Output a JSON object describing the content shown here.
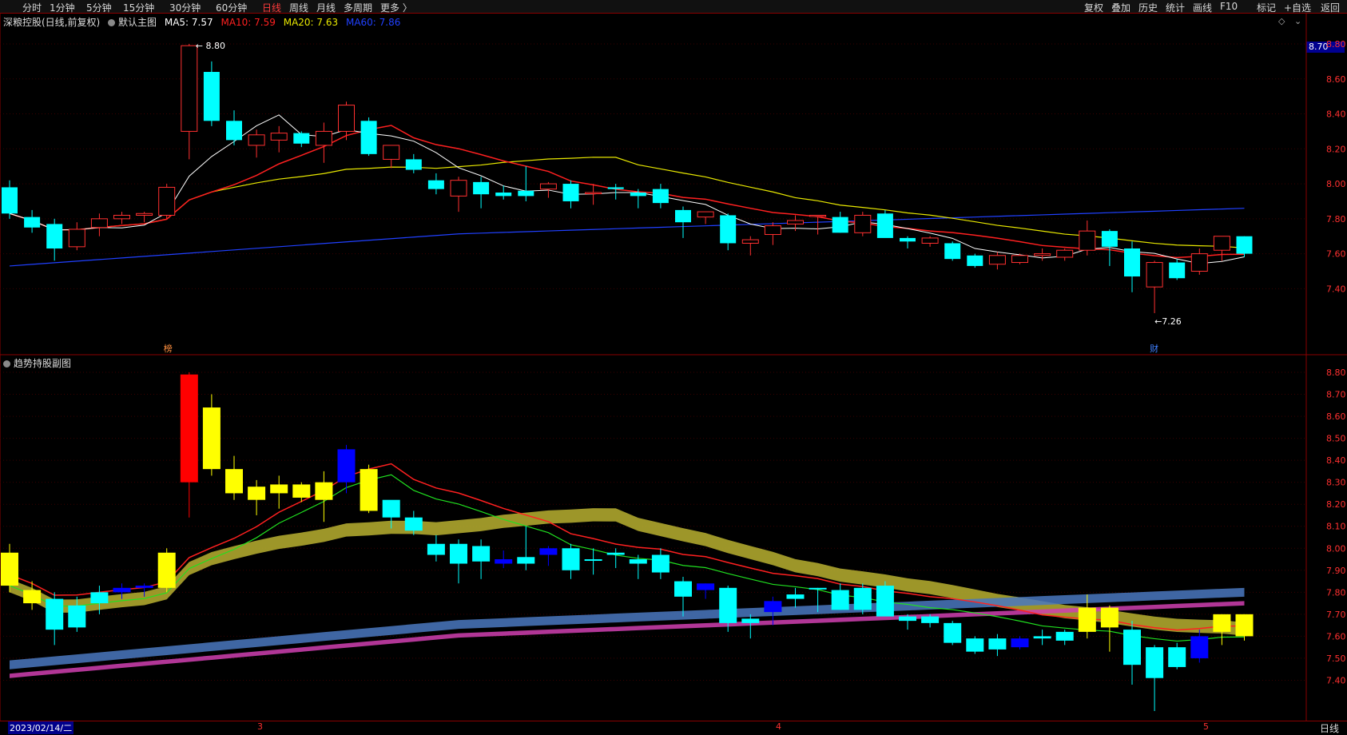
{
  "toolbar": {
    "left": [
      "分时",
      "1分钟",
      "5分钟",
      "15分钟",
      "30分钟",
      "60分钟",
      "日线",
      "周线",
      "月线",
      "多周期",
      "更多 〉"
    ],
    "active": "日线",
    "right": [
      "复权",
      "叠加",
      "历史",
      "统计",
      "画线",
      "F10",
      "标记",
      "+自选",
      "返回"
    ]
  },
  "main_panel": {
    "title": "深粮控股(日线,前复权)",
    "indicator": "默认主图",
    "ma": [
      {
        "label": "MA5: 7.57",
        "color": "#ffffff"
      },
      {
        "label": "MA10: 7.59",
        "color": "#ff2020"
      },
      {
        "label": "MA20: 7.63",
        "color": "#e8e800"
      },
      {
        "label": "MA60: 7.86",
        "color": "#2040ff"
      }
    ],
    "high_label": "8.80",
    "low_label": "←7.26",
    "high_marker": "榜",
    "low_marker": "财",
    "current_price_tag": "8.70",
    "y_ticks": [
      "8.80",
      "8.60",
      "8.40",
      "8.20",
      "8.00",
      "7.80",
      "7.60",
      "7.40"
    ]
  },
  "sub_panel": {
    "title": "趋势持股副图",
    "y_ticks": [
      "8.80",
      "8.70",
      "8.60",
      "8.50",
      "8.40",
      "8.30",
      "8.20",
      "8.10",
      "8.00",
      "7.90",
      "7.80",
      "7.70",
      "7.60",
      "7.50",
      "7.40"
    ]
  },
  "bottom": {
    "date": "2023/02/14/二",
    "months": [
      "3",
      "4",
      "5"
    ],
    "period": "日线"
  },
  "colors": {
    "up": "#ff3030",
    "down": "#00ffff",
    "ma5": "#ffffff",
    "ma10": "#ff2020",
    "ma20": "#e8e800",
    "ma60": "#2040ff",
    "border": "#8a0000",
    "sub_yellow": "#ffff00",
    "sub_cyan": "#00ffff",
    "sub_red": "#ff0000",
    "sub_blue": "#0000ff"
  },
  "chart_data": {
    "type": "candlestick",
    "candles": [
      [
        7.98,
        8.02,
        7.8,
        7.83
      ],
      [
        7.81,
        7.85,
        7.72,
        7.75
      ],
      [
        7.77,
        7.8,
        7.56,
        7.63
      ],
      [
        7.64,
        7.78,
        7.62,
        7.74
      ],
      [
        7.75,
        7.83,
        7.7,
        7.8
      ],
      [
        7.8,
        7.84,
        7.77,
        7.82
      ],
      [
        7.82,
        7.84,
        7.78,
        7.83
      ],
      [
        7.82,
        8.0,
        7.8,
        7.98
      ],
      [
        8.3,
        8.8,
        8.14,
        8.79
      ],
      [
        8.64,
        8.7,
        8.33,
        8.36
      ],
      [
        8.36,
        8.42,
        8.22,
        8.25
      ],
      [
        8.22,
        8.31,
        8.15,
        8.28
      ],
      [
        8.25,
        8.33,
        8.18,
        8.29
      ],
      [
        8.29,
        8.3,
        8.21,
        8.23
      ],
      [
        8.22,
        8.35,
        8.12,
        8.3
      ],
      [
        8.3,
        8.47,
        8.25,
        8.45
      ],
      [
        8.36,
        8.38,
        8.16,
        8.17
      ],
      [
        8.14,
        8.2,
        8.09,
        8.22
      ],
      [
        8.14,
        8.17,
        8.06,
        8.08
      ],
      [
        8.02,
        8.06,
        7.94,
        7.97
      ],
      [
        7.93,
        8.04,
        7.84,
        8.02
      ],
      [
        8.01,
        8.04,
        7.86,
        7.94
      ],
      [
        7.95,
        7.99,
        7.91,
        7.93
      ],
      [
        7.96,
        8.1,
        7.9,
        7.93
      ],
      [
        7.97,
        8.01,
        7.92,
        8.0
      ],
      [
        8.0,
        8.02,
        7.86,
        7.9
      ],
      [
        7.95,
        8.0,
        7.88,
        7.95
      ],
      [
        7.98,
        8.0,
        7.91,
        7.97
      ],
      [
        7.95,
        7.97,
        7.86,
        7.93
      ],
      [
        7.97,
        8.0,
        7.86,
        7.89
      ],
      [
        7.85,
        7.87,
        7.69,
        7.78
      ],
      [
        7.81,
        7.84,
        7.77,
        7.84
      ],
      [
        7.82,
        7.83,
        7.62,
        7.66
      ],
      [
        7.66,
        7.7,
        7.59,
        7.68
      ],
      [
        7.71,
        7.78,
        7.65,
        7.76
      ],
      [
        7.77,
        7.82,
        7.73,
        7.79
      ],
      [
        7.82,
        7.82,
        7.71,
        7.82
      ],
      [
        7.81,
        7.84,
        7.72,
        7.72
      ],
      [
        7.72,
        7.84,
        7.7,
        7.82
      ],
      [
        7.83,
        7.85,
        7.7,
        7.69
      ],
      [
        7.69,
        7.7,
        7.63,
        7.67
      ],
      [
        7.66,
        7.7,
        7.64,
        7.69
      ],
      [
        7.66,
        7.67,
        7.56,
        7.57
      ],
      [
        7.59,
        7.6,
        7.52,
        7.53
      ],
      [
        7.54,
        7.61,
        7.51,
        7.59
      ],
      [
        7.55,
        7.6,
        7.54,
        7.59
      ],
      [
        7.59,
        7.63,
        7.56,
        7.6
      ],
      [
        7.58,
        7.63,
        7.56,
        7.62
      ],
      [
        7.62,
        7.79,
        7.59,
        7.73
      ],
      [
        7.73,
        7.74,
        7.53,
        7.64
      ],
      [
        7.63,
        7.67,
        7.38,
        7.47
      ],
      [
        7.41,
        7.56,
        7.26,
        7.55
      ],
      [
        7.55,
        7.57,
        7.45,
        7.46
      ],
      [
        7.5,
        7.63,
        7.48,
        7.6
      ],
      [
        7.62,
        7.7,
        7.56,
        7.7
      ],
      [
        7.7,
        7.7,
        7.58,
        7.6
      ]
    ],
    "sub_colors": [
      "y",
      "y",
      "c",
      "c",
      "c",
      "b",
      "b",
      "y",
      "r",
      "y",
      "y",
      "y",
      "y",
      "y",
      "y",
      "b",
      "y",
      "c",
      "c",
      "c",
      "c",
      "c",
      "b",
      "c",
      "b",
      "c",
      "c",
      "c",
      "c",
      "c",
      "c",
      "b",
      "c",
      "c",
      "b",
      "c",
      "c",
      "c",
      "c",
      "c",
      "c",
      "c",
      "c",
      "c",
      "c",
      "b",
      "c",
      "c",
      "y",
      "y",
      "c",
      "c",
      "c",
      "b",
      "y",
      "y"
    ],
    "y_range_main": [
      7.26,
      8.8
    ],
    "y_range_sub": [
      7.26,
      8.8
    ]
  }
}
